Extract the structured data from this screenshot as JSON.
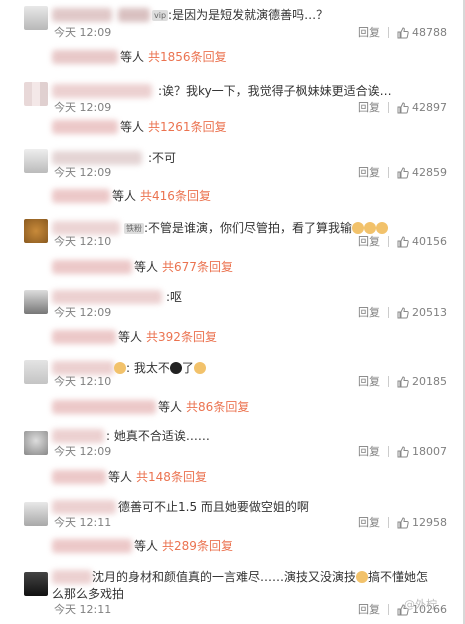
{
  "labels": {
    "reply": "回复",
    "suffix_people": "等人",
    "total_prefix": "共",
    "total_suffix": "条回复"
  },
  "comments": [
    {
      "text": "是因为是短发就演德善吗…？",
      "time": "今天 12:09",
      "likes": "48788",
      "reply_count": "1856"
    },
    {
      "text": "诶？我ky一下，我觉得子枫妹妹更适合诶…",
      "time": "今天 12:09",
      "likes": "42897",
      "reply_count": "1261"
    },
    {
      "text": "不可",
      "time": "今天 12:09",
      "likes": "42859",
      "reply_count": "416"
    },
    {
      "text": "不管是谁演，你们尽管拍，看了算我输",
      "time": "今天 12:10",
      "likes": "40156",
      "reply_count": "677"
    },
    {
      "text": "呕",
      "time": "今天 12:09",
      "likes": "20513",
      "reply_count": "392"
    },
    {
      "text": "我太不",
      "text2": "了",
      "time": "今天 12:10",
      "likes": "20185",
      "reply_count": "86"
    },
    {
      "text": "她真不合适诶……",
      "time": "今天 12:09",
      "likes": "18007",
      "reply_count": "148"
    },
    {
      "text": "德善可不止1.5 而且她要做空姐的啊",
      "time": "今天 12:11",
      "likes": "12958",
      "reply_count": "289"
    },
    {
      "text": "沈月的身材和颜值真的一言难尽……演技又没演技",
      "text2": "搞不懂她怎么那么多戏拍",
      "time": "今天 12:11",
      "likes": "10266",
      "reply_count": null
    }
  ],
  "badge": "vip",
  "badge2": "铁粉",
  "watermark": "@外柠"
}
